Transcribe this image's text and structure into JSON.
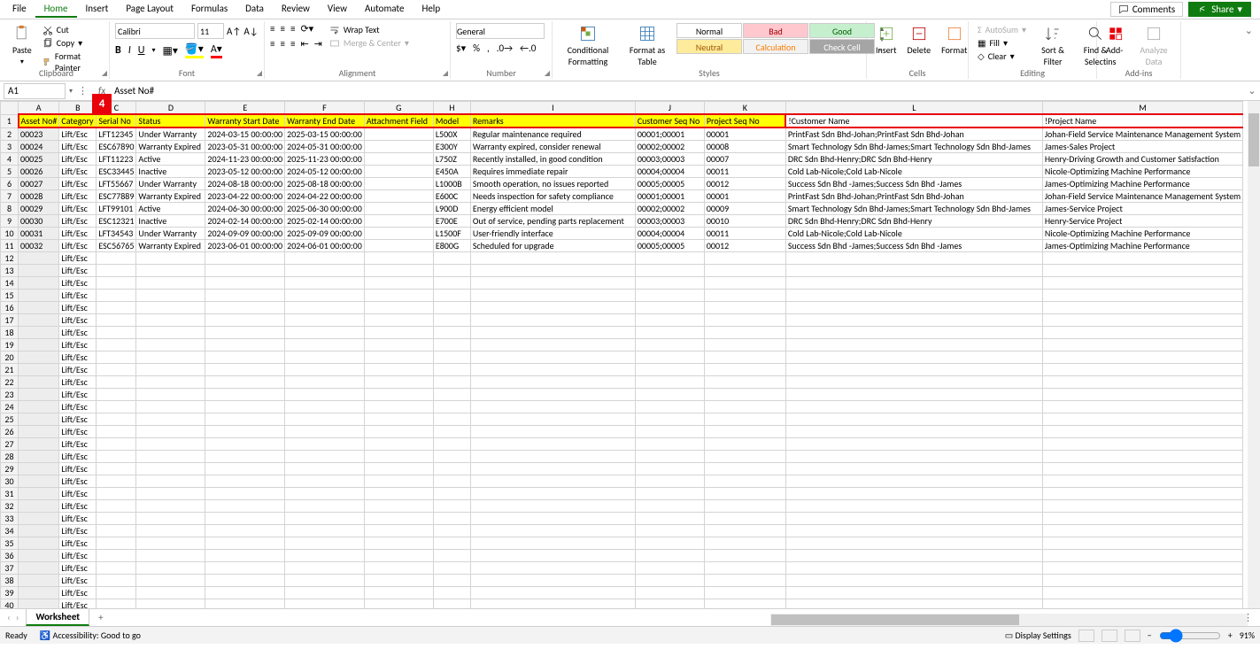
{
  "menu": {
    "items": [
      "File",
      "Home",
      "Insert",
      "Page Layout",
      "Formulas",
      "Data",
      "Review",
      "View",
      "Automate",
      "Help"
    ],
    "comments": "Comments",
    "share": "Share"
  },
  "ribbon": {
    "clipboard": {
      "paste": "Paste",
      "cut": "Cut",
      "copy": "Copy",
      "format_painter": "Format Painter",
      "label": "Clipboard"
    },
    "font": {
      "name": "Calibri",
      "size": "11",
      "label": "Font"
    },
    "alignment": {
      "wrap": "Wrap Text",
      "merge": "Merge & Center",
      "label": "Alignment"
    },
    "number": {
      "format": "General",
      "label": "Number"
    },
    "styles": {
      "cond": "Conditional Formatting",
      "table": "Format as Table",
      "cells": [
        "Normal",
        "Bad",
        "Good",
        "Neutral",
        "Calculation",
        "Check Cell"
      ],
      "label": "Styles"
    },
    "cells": {
      "insert": "Insert",
      "delete": "Delete",
      "format": "Format",
      "label": "Cells"
    },
    "editing": {
      "autosum": "AutoSum",
      "fill": "Fill",
      "clear": "Clear",
      "sort": "Sort & Filter",
      "find": "Find & Select",
      "label": "Editing"
    },
    "addins": {
      "addins": "Add-ins",
      "analyze": "Analyze Data",
      "label": "Add-ins"
    }
  },
  "namebox": "A1",
  "formula": "Asset No#",
  "callout": "4",
  "columns": [
    "A",
    "B",
    "C",
    "D",
    "E",
    "F",
    "G",
    "H",
    "I",
    "J",
    "K",
    "L",
    "M"
  ],
  "headers": [
    "Asset No#",
    "Category",
    "Serial No",
    "Status",
    "Warranty Start Date",
    "Warranty End Date",
    "Attachment Field",
    "Model",
    "Remarks",
    "Customer Seq No",
    "Project Seq No",
    "!Customer Name",
    "!Project Name"
  ],
  "rows": [
    [
      "00023",
      "Lift/Esc",
      "LFT12345",
      "Under Warranty",
      "2024-03-15 00:00:00",
      "2025-03-15 00:00:00",
      "",
      "L500X",
      "Regular maintenance required",
      "00001;00001",
      "00001",
      "PrintFast Sdn Bhd-Johan;PrintFast Sdn Bhd-Johan",
      "Johan-Field Service Maintenance Management System"
    ],
    [
      "00024",
      "Lift/Esc",
      "ESC67890",
      "Warranty Expired",
      "2023-05-31 00:00:00",
      "2024-05-31 00:00:00",
      "",
      "E300Y",
      "Warranty expired, consider renewal",
      "00002;00002",
      "00008",
      "Smart Technology Sdn Bhd-James;Smart Technology Sdn Bhd-James",
      "James-Sales Project"
    ],
    [
      "00025",
      "Lift/Esc",
      "LFT11223",
      "Active",
      "2024-11-23 00:00:00",
      "2025-11-23 00:00:00",
      "",
      "L750Z",
      "Recently installed, in good condition",
      "00003;00003",
      "00007",
      "DRC Sdn Bhd-Henry;DRC Sdn Bhd-Henry",
      "Henry-Driving Growth and Customer Satisfaction"
    ],
    [
      "00026",
      "Lift/Esc",
      "ESC33445",
      "Inactive",
      "2023-05-12 00:00:00",
      "2024-05-12 00:00:00",
      "",
      "E450A",
      "Requires immediate repair",
      "00004;00004",
      "00011",
      "Cold Lab-Nicole;Cold Lab-Nicole",
      "Nicole-Optimizing Machine Performance"
    ],
    [
      "00027",
      "Lift/Esc",
      "LFT55667",
      "Under Warranty",
      "2024-08-18 00:00:00",
      "2025-08-18 00:00:00",
      "",
      "L1000B",
      "Smooth operation, no issues reported",
      "00005;00005",
      "00012",
      "Success Sdn Bhd -James;Success Sdn Bhd -James",
      "James-Optimizing Machine Performance"
    ],
    [
      "00028",
      "Lift/Esc",
      "ESC77889",
      "Warranty Expired",
      "2023-04-22 00:00:00",
      "2024-04-22 00:00:00",
      "",
      "E600C",
      "Needs inspection for safety compliance",
      "00001;00001",
      "00001",
      "PrintFast Sdn Bhd-Johan;PrintFast Sdn Bhd-Johan",
      "Johan-Field Service Maintenance Management System"
    ],
    [
      "00029",
      "Lift/Esc",
      "LFT99101",
      "Active",
      "2024-06-30 00:00:00",
      "2025-06-30 00:00:00",
      "",
      "L900D",
      "Energy efficient model",
      "00002;00002",
      "00009",
      "Smart Technology Sdn Bhd-James;Smart Technology Sdn Bhd-James",
      "James-Service Project"
    ],
    [
      "00030",
      "Lift/Esc",
      "ESC12321",
      "Inactive",
      "2024-02-14 00:00:00",
      "2025-02-14 00:00:00",
      "",
      "E700E",
      "Out of service, pending parts replacement",
      "00003;00003",
      "00010",
      "DRC Sdn Bhd-Henry;DRC Sdn Bhd-Henry",
      "Henry-Service Project"
    ],
    [
      "00031",
      "Lift/Esc",
      "LFT34543",
      "Under Warranty",
      "2024-09-09 00:00:00",
      "2025-09-09 00:00:00",
      "",
      "L1500F",
      "User-friendly interface",
      "00004;00004",
      "00011",
      "Cold Lab-Nicole;Cold Lab-Nicole",
      "Nicole-Optimizing Machine Performance"
    ],
    [
      "00032",
      "Lift/Esc",
      "ESC56765",
      "Warranty Expired",
      "2023-06-01 00:00:00",
      "2024-06-01 00:00:00",
      "",
      "E800G",
      "Scheduled for upgrade",
      "00005;00005",
      "00012",
      "Success Sdn Bhd -James;Success Sdn Bhd -James",
      "James-Optimizing Machine Performance"
    ]
  ],
  "fill_rows": 32,
  "fill_category": "Lift/Esc",
  "sheet_tab": "Worksheet",
  "status": {
    "ready": "Ready",
    "access": "Accessibility: Good to go",
    "display": "Display Settings",
    "zoom": "91%"
  }
}
